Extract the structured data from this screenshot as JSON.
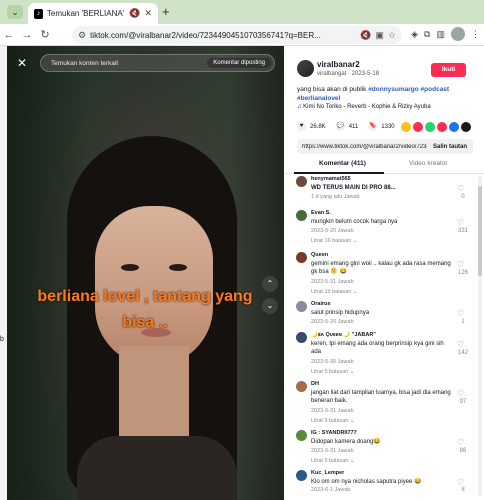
{
  "browser": {
    "tab_title": "Temukan 'BERLIANA' di Tik",
    "tab_favicon": "TikTok",
    "url": "tiktok.com/@viralbanar2/video/723449045107035674​1?q=BER...",
    "new_tab": "+"
  },
  "video": {
    "search_placeholder": "Temukan konten terkait",
    "search_button": "Komentar diposting",
    "caption": "berliana lovel , tantang yang bisa ..",
    "close_symbol": "✕",
    "up_symbol": "⌃",
    "down_symbol": "⌄"
  },
  "profile": {
    "name": "viralbanar2",
    "subline": "viralbangat · 2023-5-18",
    "follow_label": "Ikuti",
    "description": "yang bisa akan di publik ",
    "hashtags": "#donnysumargo #podcast #berlianalovel",
    "music": "♫  Kimi No Toriko - Reverb - Kophie & Rizky Ayuba",
    "likes": "26.8K",
    "comments_count": "411",
    "saves": "1330",
    "share_colors": [
      "#fcbf1e",
      "#fe2c55",
      "#25d366",
      "#fe2c55",
      "#1877f2",
      "#161823"
    ]
  },
  "link": {
    "value": "https://www.tiktok.com/@viralbanar2/video/72344...",
    "copy_label": "Salin tautan"
  },
  "tabs": {
    "comments": "Komentar (411)",
    "creator_videos": "Video kreator"
  },
  "comments": [
    {
      "user": "henymamat565",
      "text": "WD TERUS MAIN DI PRO 88...",
      "meta": "1 d yang lalu    Jawab",
      "replies": "",
      "likes": "0",
      "color": "#6b4c3b"
    },
    {
      "user": "Evan S.",
      "text": "mungkin belum cocok harga nya",
      "meta": "2023-5-20    Jawab",
      "replies": "Lihat 16 balasan ⌄",
      "likes": "331",
      "color": "#4a6a3a"
    },
    {
      "user": "Queen",
      "text": "gemini emang gini woii .. kalau gk ada rasa memang gk bsa 🫠 😂",
      "meta": "2023-5-31    Jawab",
      "replies": "Lihat 19 balasan ⌄",
      "likes": "126",
      "color": "#7a3a2a"
    },
    {
      "user": "Orairus",
      "text": "salut prinsip hidupnya",
      "meta": "2023-5-20    Jawab",
      "replies": "",
      "likes": "1",
      "color": "#8a8a9a"
    },
    {
      "user": "🌙ꜱᴀ Ǫᴜᴇᴇɴ 🌙 \"JABAR\"",
      "text": "keren, tpi emang ada orang berprinsip kya gini sih ada",
      "meta": "2023-5-30    Jawab",
      "replies": "Lihat 5 balasan ⌄",
      "likes": "142",
      "color": "#3a4a6a"
    },
    {
      "user": "DH",
      "text": "jangan liat dari tampilan luarnya, bisa jadi dia emang beneran baik.",
      "meta": "2023-5-31    Jawab",
      "replies": "Lihat 3 balasan ⌄",
      "likes": "97",
      "color": "#a86a4a"
    },
    {
      "user": "IG : SYANDRII777",
      "text": "Didopan kamera doang😂",
      "meta": "2023-5-31    Jawab",
      "replies": "Lihat 5 balasan ⌄",
      "likes": "86",
      "color": "#5a8a3a"
    },
    {
      "user": "Kuc_Lemper",
      "text": "Klo om om nya nicholas saputra piyee 😂",
      "meta": "2023-6-1    Jawab",
      "replies": "",
      "likes": "8",
      "color": "#2a5a8a"
    }
  ]
}
